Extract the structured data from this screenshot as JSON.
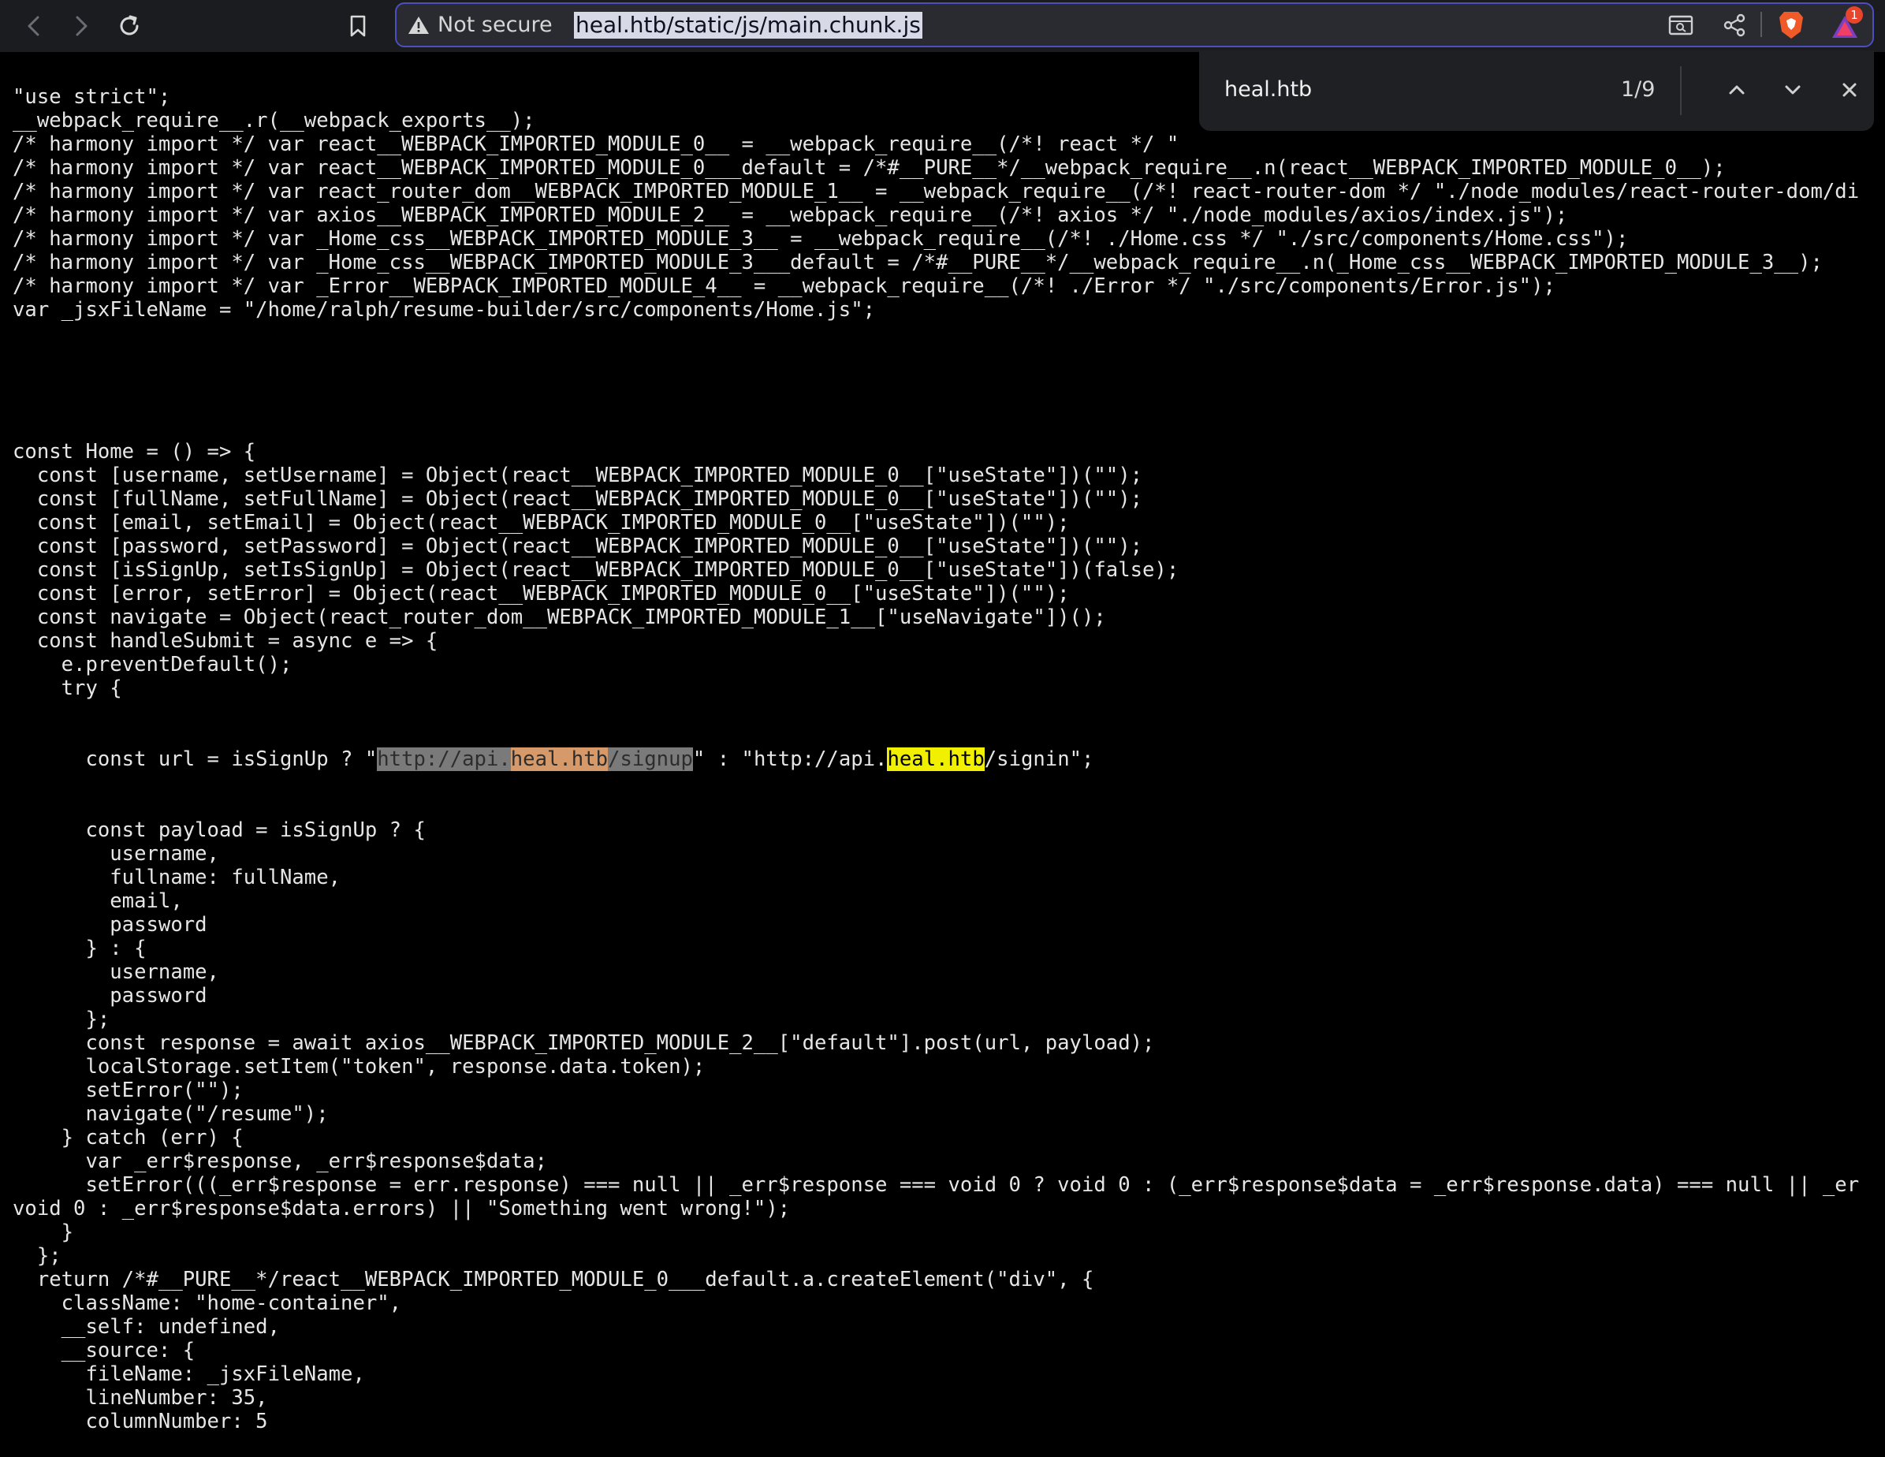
{
  "browser": {
    "security_label": "Not secure",
    "url": "heal.htb/static/js/main.chunk.js",
    "notification_count": "1",
    "colors": {
      "toolbar": "#1b1c20",
      "url_border": "#4d4ec0",
      "brave": "#f05a28"
    }
  },
  "find_bar": {
    "query": "heal.htb",
    "match_count": "1/9"
  },
  "code": {
    "lines_top": [
      "\"use strict\";",
      "__webpack_require__.r(__webpack_exports__);",
      "/* harmony import */ var react__WEBPACK_IMPORTED_MODULE_0__ = __webpack_require__(/*! react */ \"",
      "/* harmony import */ var react__WEBPACK_IMPORTED_MODULE_0___default = /*#__PURE__*/__webpack_require__.n(react__WEBPACK_IMPORTED_MODULE_0__);",
      "/* harmony import */ var react_router_dom__WEBPACK_IMPORTED_MODULE_1__ = __webpack_require__(/*! react-router-dom */ \"./node_modules/react-router-dom/di",
      "/* harmony import */ var axios__WEBPACK_IMPORTED_MODULE_2__ = __webpack_require__(/*! axios */ \"./node_modules/axios/index.js\");",
      "/* harmony import */ var _Home_css__WEBPACK_IMPORTED_MODULE_3__ = __webpack_require__(/*! ./Home.css */ \"./src/components/Home.css\");",
      "/* harmony import */ var _Home_css__WEBPACK_IMPORTED_MODULE_3___default = /*#__PURE__*/__webpack_require__.n(_Home_css__WEBPACK_IMPORTED_MODULE_3__);",
      "/* harmony import */ var _Error__WEBPACK_IMPORTED_MODULE_4__ = __webpack_require__(/*! ./Error */ \"./src/components/Error.js\");",
      "var _jsxFileName = \"/home/ralph/resume-builder/src/components/Home.js\";",
      "",
      "",
      "",
      "",
      "",
      "const Home = () => {",
      "  const [username, setUsername] = Object(react__WEBPACK_IMPORTED_MODULE_0__[\"useState\"])(\"\");",
      "  const [fullName, setFullName] = Object(react__WEBPACK_IMPORTED_MODULE_0__[\"useState\"])(\"\");",
      "  const [email, setEmail] = Object(react__WEBPACK_IMPORTED_MODULE_0__[\"useState\"])(\"\");",
      "  const [password, setPassword] = Object(react__WEBPACK_IMPORTED_MODULE_0__[\"useState\"])(\"\");",
      "  const [isSignUp, setIsSignUp] = Object(react__WEBPACK_IMPORTED_MODULE_0__[\"useState\"])(false);",
      "  const [error, setError] = Object(react__WEBPACK_IMPORTED_MODULE_0__[\"useState\"])(\"\");",
      "  const navigate = Object(react_router_dom__WEBPACK_IMPORTED_MODULE_1__[\"useNavigate\"])();",
      "  const handleSubmit = async e => {",
      "    e.preventDefault();",
      "    try {"
    ],
    "url_line": {
      "prefix": "      const url = isSignUp ? \"",
      "cur_a": "http://api.",
      "cur_match": "heal.htb",
      "cur_b": "/signup",
      "middle": "\" : \"http://api.",
      "match": "heal.htb",
      "suffix": "/signin\";"
    },
    "lines_bottom": [
      "      const payload = isSignUp ? {",
      "        username,",
      "        fullname: fullName,",
      "        email,",
      "        password",
      "      } : {",
      "        username,",
      "        password",
      "      };",
      "      const response = await axios__WEBPACK_IMPORTED_MODULE_2__[\"default\"].post(url, payload);",
      "      localStorage.setItem(\"token\", response.data.token);",
      "      setError(\"\");",
      "      navigate(\"/resume\");",
      "    } catch (err) {",
      "      var _err$response, _err$response$data;",
      "      setError(((_err$response = err.response) === null || _err$response === void 0 ? void 0 : (_err$response$data = _err$response.data) === null || _er",
      "void 0 : _err$response$data.errors) || \"Something went wrong!\");",
      "    }",
      "  };",
      "  return /*#__PURE__*/react__WEBPACK_IMPORTED_MODULE_0___default.a.createElement(\"div\", {",
      "    className: \"home-container\",",
      "    __self: undefined,",
      "    __source: {",
      "      fileName: _jsxFileName,",
      "      lineNumber: 35,",
      "      columnNumber: 5"
    ]
  }
}
